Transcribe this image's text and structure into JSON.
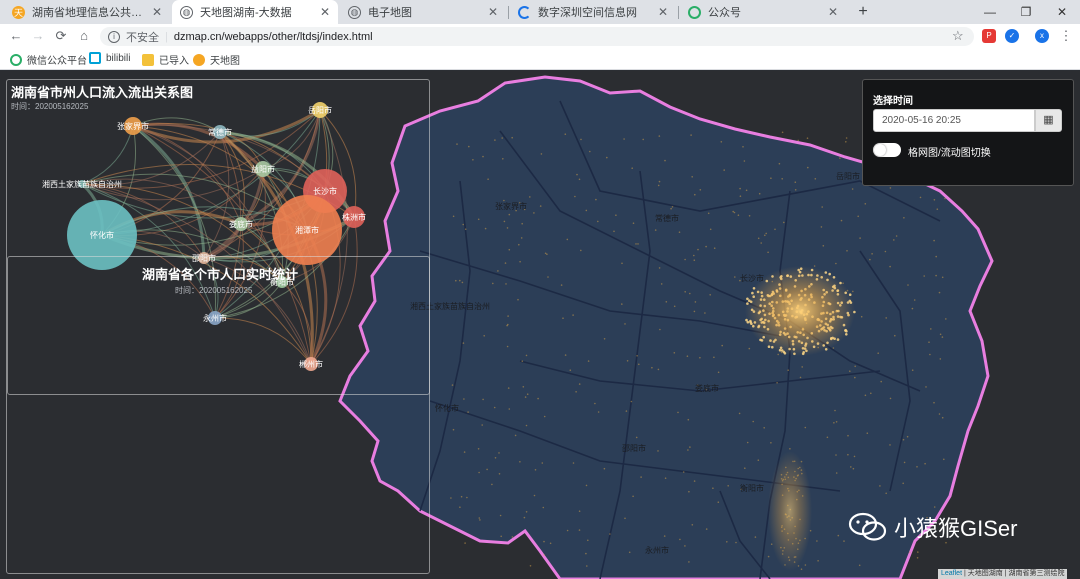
{
  "browser": {
    "tabs": [
      {
        "title": "湖南省地理信息公共服务平台 天",
        "icon": "tianditu-icon",
        "active": false
      },
      {
        "title": "天地图湖南-大数据",
        "icon": "globe-icon",
        "active": true
      },
      {
        "title": "电子地图",
        "icon": "globe-icon",
        "active": false
      },
      {
        "title": "数字深圳空间信息网",
        "icon": "loading-icon",
        "active": false
      },
      {
        "title": "公众号",
        "icon": "wechat-icon",
        "active": false
      }
    ],
    "new_tab": "+",
    "window": {
      "minimize": "—",
      "restore": "❐",
      "close": "✕"
    },
    "address": {
      "security": "不安全",
      "url": "dzmap.cn/webapps/other/ltdsj/index.html"
    },
    "profile": "x",
    "bookmarks": [
      {
        "label": "微信公众平台",
        "icon": "wechat-icon",
        "color": "#2aae67"
      },
      {
        "label": "bilibili",
        "icon": "bilibili-icon",
        "color": "#00a1d6"
      },
      {
        "label": "已导入",
        "icon": "folder-icon",
        "color": "#f3c13a"
      },
      {
        "label": "天地图",
        "icon": "tianditu-icon",
        "color": "#f5a623"
      }
    ]
  },
  "panel_flow": {
    "title": "湖南省市州人口流入流出关系图",
    "subtitle": "时间：202005162025",
    "nodes": [
      {
        "name": "岳阳市",
        "color": "#f2d16b"
      },
      {
        "name": "张家界市",
        "color": "#f0a04b"
      },
      {
        "name": "常德市",
        "color": "#8fb9c2"
      },
      {
        "name": "益阳市",
        "color": "#a7c9a2"
      },
      {
        "name": "长沙市",
        "color": "#e0625a"
      },
      {
        "name": "湘西土家族苗族自治州",
        "color": "#7fb7b0"
      },
      {
        "name": "株洲市",
        "color": "#e0625a"
      },
      {
        "name": "怀化市",
        "color": "#6cc1c3"
      },
      {
        "name": "娄底市",
        "color": "#a7c9a2"
      },
      {
        "name": "湘潭市",
        "color": "#f08050"
      },
      {
        "name": "邵阳市",
        "color": "#e0b49a"
      },
      {
        "name": "衡阳市",
        "color": "#9fcaa0"
      },
      {
        "name": "永州市",
        "color": "#8aa6c9"
      },
      {
        "name": "郴州市",
        "color": "#f0a890"
      }
    ]
  },
  "panel_stats": {
    "title": "湖南省各个市人口实时统计",
    "subtitle": "时间：202005162025"
  },
  "time_panel": {
    "label": "选择时间",
    "value": "2020-05-16 20:25",
    "calendar_icon": "calendar-icon",
    "toggle_label": "格网图/流动图切换"
  },
  "map_labels": [
    "张家界市",
    "常德市",
    "岳阳市",
    "湘西土家族苗族自治州",
    "长沙市",
    "娄底市",
    "怀化市",
    "邵阳市",
    "衡阳市",
    "永州市"
  ],
  "watermark": "小猿猴GISer",
  "attribution": {
    "leaflet": "Leaflet",
    "rest": " | 天地图湖南 | 湖南省第三测绘院"
  }
}
